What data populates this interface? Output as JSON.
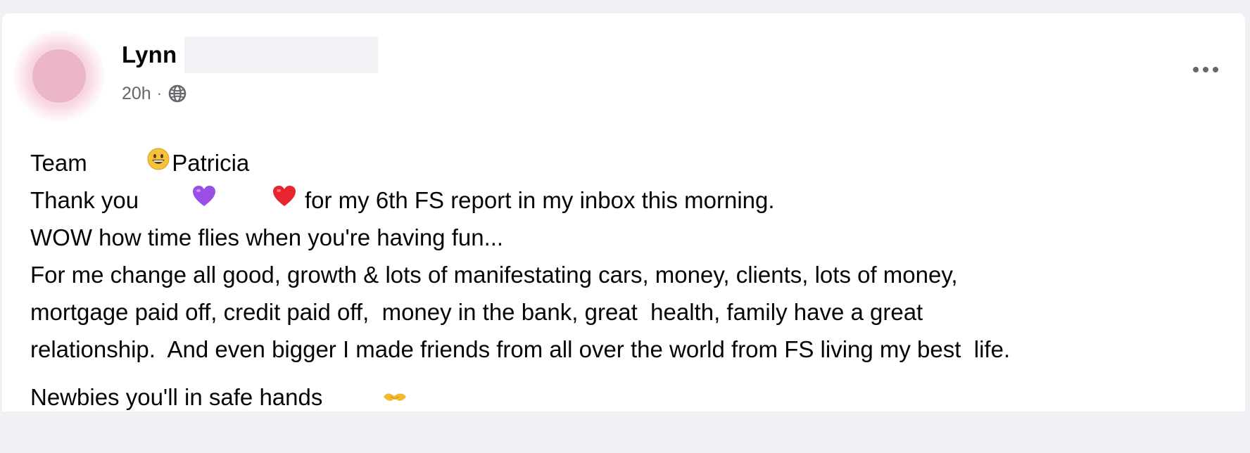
{
  "post": {
    "author": {
      "name": "Lynn",
      "avatar_color": "#ebb6c5"
    },
    "meta": {
      "time": "20h",
      "separator": "·",
      "audience_icon": "globe-icon"
    },
    "more_icon": "more-options-icon",
    "body": {
      "line1_before": "Team ",
      "line1_emoji": "grinning-face-emoji",
      "line1_after": "Patricia",
      "line2_before": "Thank you",
      "line2_emojis": [
        "purple-heart-emoji",
        "red-heart-emoji"
      ],
      "line2_after": " for my 6th FS report in my inbox this morning.",
      "line3": "WOW how time flies when you're having fun...",
      "line4": "For me change all good, growth & lots of manifestating cars, money, clients, lots of money,",
      "line5": "mortgage paid off, credit paid off,  money in the bank, great  health, family have a great",
      "line6": "relationship.  And even bigger I made friends from all over the world from FS living my best  life.",
      "line7_before": "Newbies you'll in safe hands ",
      "line7_emoji": "handshake-emoji"
    }
  },
  "colors": {
    "page_bg": "#eff1f4",
    "card_bg": "#ffffff",
    "text_primary": "#050505",
    "text_secondary": "#65676b"
  }
}
